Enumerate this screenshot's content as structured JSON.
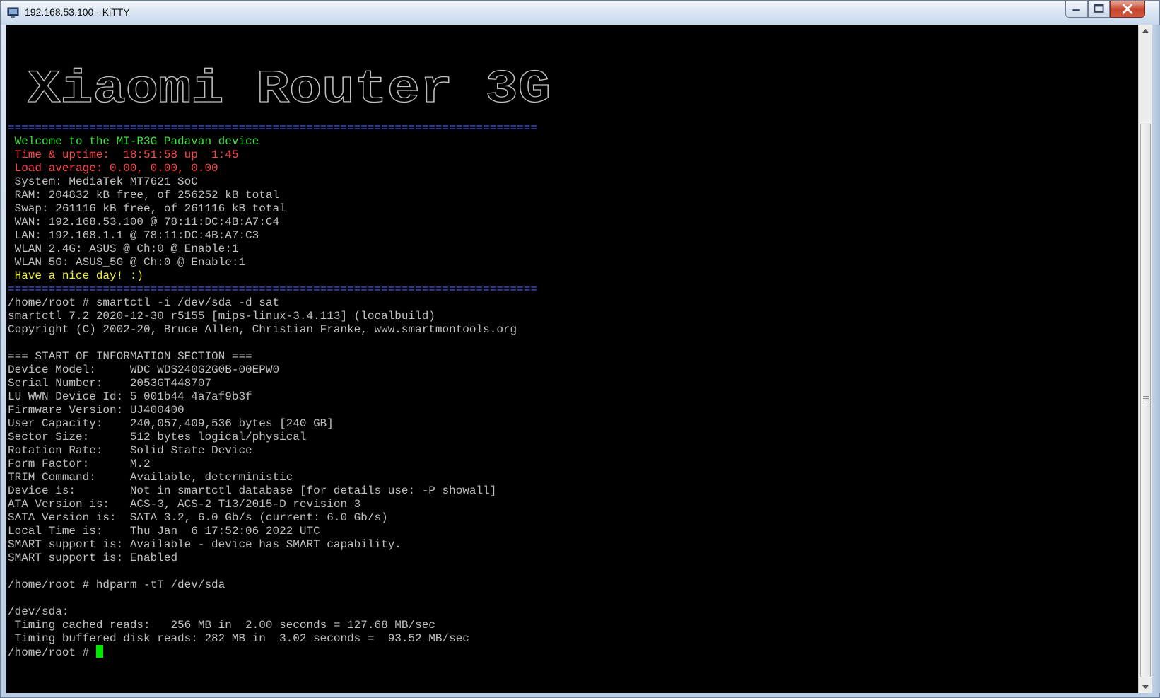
{
  "window": {
    "title": "192.168.53.100 - KiTTY"
  },
  "terminal": {
    "logo_text": "Xiaomi Router 3G",
    "separator": "==============================================================================",
    "banner": {
      "welcome": " Welcome to the MI-R3G Padavan device",
      "time": " Time & uptime:  18:51:58 up  1:45",
      "load": " Load average: 0.00, 0.00, 0.00",
      "system": " System: MediaTek MT7621 SoC",
      "ram": " RAM: 204832 kB free, of 256252 kB total",
      "swap": " Swap: 261116 kB free, of 261116 kB total",
      "wan": " WAN: 192.168.53.100 @ 78:11:DC:4B:A7:C4",
      "lan": " LAN: 192.168.1.1 @ 78:11:DC:4B:A7:C3",
      "wlan24": " WLAN 2.4G: ASUS @ Ch:0 @ Enable:1",
      "wlan5": " WLAN 5G: ASUS_5G @ Ch:0 @ Enable:1",
      "goodbye": " Have a nice day! :)"
    },
    "cmd1": "/home/root # smartctl -i /dev/sda -d sat",
    "smart_version": "smartctl 7.2 2020-12-30 r5155 [mips-linux-3.4.113] (localbuild)",
    "copyright": "Copyright (C) 2002-20, Bruce Allen, Christian Franke, www.smartmontools.org",
    "section_header": "=== START OF INFORMATION SECTION ===",
    "info": [
      "Device Model:     WDC WDS240G2G0B-00EPW0",
      "Serial Number:    2053GT448707",
      "LU WWN Device Id: 5 001b44 4a7af9b3f",
      "Firmware Version: UJ400400",
      "User Capacity:    240,057,409,536 bytes [240 GB]",
      "Sector Size:      512 bytes logical/physical",
      "Rotation Rate:    Solid State Device",
      "Form Factor:      M.2",
      "TRIM Command:     Available, deterministic",
      "Device is:        Not in smartctl database [for details use: -P showall]",
      "ATA Version is:   ACS-3, ACS-2 T13/2015-D revision 3",
      "SATA Version is:  SATA 3.2, 6.0 Gb/s (current: 6.0 Gb/s)",
      "Local Time is:    Thu Jan  6 17:52:06 2022 UTC",
      "SMART support is: Available - device has SMART capability.",
      "SMART support is: Enabled"
    ],
    "cmd2": "/home/root # hdparm -tT /dev/sda",
    "dev": "/dev/sda:",
    "timing_cached": " Timing cached reads:   256 MB in  2.00 seconds = 127.68 MB/sec",
    "timing_buffered": " Timing buffered disk reads: 282 MB in  3.02 seconds =  93.52 MB/sec",
    "prompt": "/home/root # "
  },
  "colors": {
    "background": "#000000",
    "text": "#c0c0c0",
    "green": "#3fe23f",
    "red": "#ff4545",
    "yellow": "#f2f23a",
    "blue": "#4a5cff",
    "cursor": "#00e600"
  }
}
